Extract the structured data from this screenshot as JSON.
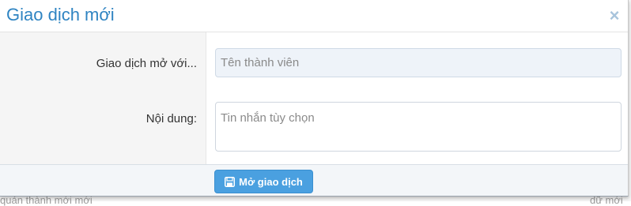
{
  "modal": {
    "title": "Giao dịch mới",
    "close_symbol": "×"
  },
  "form": {
    "recipient": {
      "label": "Giao dịch mở với...",
      "placeholder": "Tên thành viên",
      "value": ""
    },
    "content": {
      "label": "Nội dung:",
      "placeholder": "Tin nhắn tùy chọn",
      "value": ""
    }
  },
  "footer": {
    "submit_label": "Mở giao dịch",
    "submit_icon": "save-icon"
  },
  "background": {
    "partial_text_left": "quản thành mới mới",
    "partial_text_right": "dữ mới"
  },
  "colors": {
    "title": "#2f84c2",
    "button": "#4aa0e0",
    "label_column": "#f5f5f5",
    "footer": "#f3f6f9"
  }
}
